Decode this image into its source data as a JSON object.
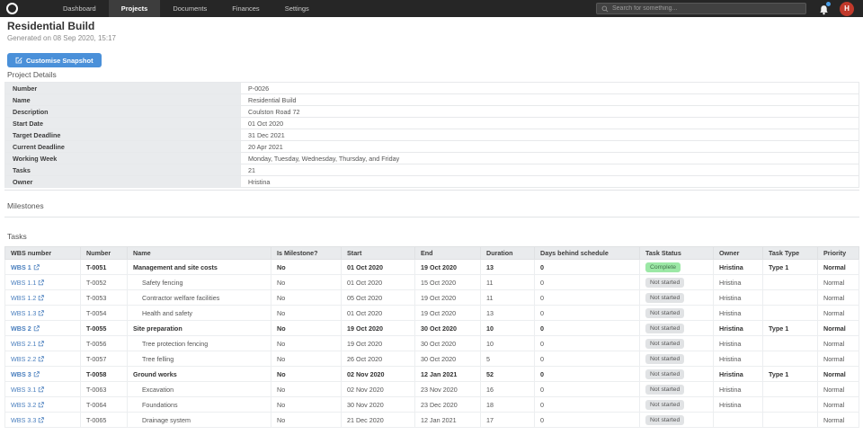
{
  "nav": {
    "items": [
      {
        "label": "Dashboard",
        "active": false
      },
      {
        "label": "Projects",
        "active": true
      },
      {
        "label": "Documents",
        "active": false
      },
      {
        "label": "Finances",
        "active": false
      },
      {
        "label": "Settings",
        "active": false
      }
    ],
    "search_placeholder": "Search for something...",
    "avatar_initial": "H",
    "icons": {
      "logo": "ring-logo",
      "search": "magnifier",
      "bell": "bell",
      "notification_dot": "blue-dot"
    }
  },
  "header": {
    "title": "Residential Build",
    "subtitle": "Generated on 08 Sep 2020, 15:17"
  },
  "toolbar": {
    "customise_button": "Customise Snapshot",
    "customise_icon": "edit-pencil-square"
  },
  "sections": {
    "project_details": "Project Details",
    "milestones": "Milestones",
    "tasks": "Tasks"
  },
  "project_details": {
    "rows": [
      {
        "label": "Number",
        "value": "P-0026"
      },
      {
        "label": "Name",
        "value": "Residential Build"
      },
      {
        "label": "Description",
        "value": "Coulston Road 72"
      },
      {
        "label": "Start Date",
        "value": "01 Oct 2020"
      },
      {
        "label": "Target Deadline",
        "value": "31 Dec 2021"
      },
      {
        "label": "Current Deadline",
        "value": "20 Apr 2021"
      },
      {
        "label": "Working Week",
        "value": "Monday, Tuesday, Wednesday, Thursday, and Friday"
      },
      {
        "label": "Tasks",
        "value": "21"
      },
      {
        "label": "Owner",
        "value": "Hristina"
      }
    ]
  },
  "tasks_table": {
    "columns": [
      "WBS number",
      "Number",
      "Name",
      "Is Milestone?",
      "Start",
      "End",
      "Duration",
      "Days behind schedule",
      "Task Status",
      "Owner",
      "Task Type",
      "Priority"
    ],
    "rows": [
      {
        "wbs": "WBS 1",
        "number": "T-0051",
        "name": "Management and site costs",
        "is_milestone": "No",
        "start": "01 Oct 2020",
        "end": "19 Oct 2020",
        "duration": "13",
        "days_behind": "0",
        "status": "Complete",
        "owner": "Hristina",
        "task_type": "Type 1",
        "priority": "Normal",
        "level": 0
      },
      {
        "wbs": "WBS 1.1",
        "number": "T-0052",
        "name": "Safety fencing",
        "is_milestone": "No",
        "start": "01 Oct 2020",
        "end": "15 Oct 2020",
        "duration": "11",
        "days_behind": "0",
        "status": "Not started",
        "owner": "Hristina",
        "task_type": "",
        "priority": "Normal",
        "level": 1
      },
      {
        "wbs": "WBS 1.2",
        "number": "T-0053",
        "name": "Contractor welfare facilities",
        "is_milestone": "No",
        "start": "05 Oct 2020",
        "end": "19 Oct 2020",
        "duration": "11",
        "days_behind": "0",
        "status": "Not started",
        "owner": "Hristina",
        "task_type": "",
        "priority": "Normal",
        "level": 1
      },
      {
        "wbs": "WBS 1.3",
        "number": "T-0054",
        "name": "Health and safety",
        "is_milestone": "No",
        "start": "01 Oct 2020",
        "end": "19 Oct 2020",
        "duration": "13",
        "days_behind": "0",
        "status": "Not started",
        "owner": "Hristina",
        "task_type": "",
        "priority": "Normal",
        "level": 1
      },
      {
        "wbs": "WBS 2",
        "number": "T-0055",
        "name": "Site preparation",
        "is_milestone": "No",
        "start": "19 Oct 2020",
        "end": "30 Oct 2020",
        "duration": "10",
        "days_behind": "0",
        "status": "Not started",
        "owner": "Hristina",
        "task_type": "Type 1",
        "priority": "Normal",
        "level": 0
      },
      {
        "wbs": "WBS 2.1",
        "number": "T-0056",
        "name": "Tree protection fencing",
        "is_milestone": "No",
        "start": "19 Oct 2020",
        "end": "30 Oct 2020",
        "duration": "10",
        "days_behind": "0",
        "status": "Not started",
        "owner": "Hristina",
        "task_type": "",
        "priority": "Normal",
        "level": 1
      },
      {
        "wbs": "WBS 2.2",
        "number": "T-0057",
        "name": "Tree felling",
        "is_milestone": "No",
        "start": "26 Oct 2020",
        "end": "30 Oct 2020",
        "duration": "5",
        "days_behind": "0",
        "status": "Not started",
        "owner": "Hristina",
        "task_type": "",
        "priority": "Normal",
        "level": 1
      },
      {
        "wbs": "WBS 3",
        "number": "T-0058",
        "name": "Ground works",
        "is_milestone": "No",
        "start": "02 Nov 2020",
        "end": "12 Jan 2021",
        "duration": "52",
        "days_behind": "0",
        "status": "Not started",
        "owner": "Hristina",
        "task_type": "Type 1",
        "priority": "Normal",
        "level": 0
      },
      {
        "wbs": "WBS 3.1",
        "number": "T-0063",
        "name": "Excavation",
        "is_milestone": "No",
        "start": "02 Nov 2020",
        "end": "23 Nov 2020",
        "duration": "16",
        "days_behind": "0",
        "status": "Not started",
        "owner": "Hristina",
        "task_type": "",
        "priority": "Normal",
        "level": 1
      },
      {
        "wbs": "WBS 3.2",
        "number": "T-0064",
        "name": "Foundations",
        "is_milestone": "No",
        "start": "30 Nov 2020",
        "end": "23 Dec 2020",
        "duration": "18",
        "days_behind": "0",
        "status": "Not started",
        "owner": "Hristina",
        "task_type": "",
        "priority": "Normal",
        "level": 1
      },
      {
        "wbs": "WBS 3.3",
        "number": "T-0065",
        "name": "Drainage system",
        "is_milestone": "No",
        "start": "21 Dec 2020",
        "end": "12 Jan 2021",
        "duration": "17",
        "days_behind": "0",
        "status": "Not started",
        "owner": "",
        "task_type": "",
        "priority": "Normal",
        "level": 1
      }
    ]
  },
  "colors": {
    "navbar_bg": "#262626",
    "navbar_active_bg": "#3d3d3d",
    "search_bg": "#414141",
    "accent_blue": "#4a90d9",
    "link_blue": "#4a7fbe",
    "status_complete_bg": "#9ce8a6",
    "status_notstarted_bg": "#e1e3e5",
    "label_bg": "#e9ebed",
    "avatar_red": "#c0392b",
    "badge_dot_blue": "#4a9fe8"
  }
}
